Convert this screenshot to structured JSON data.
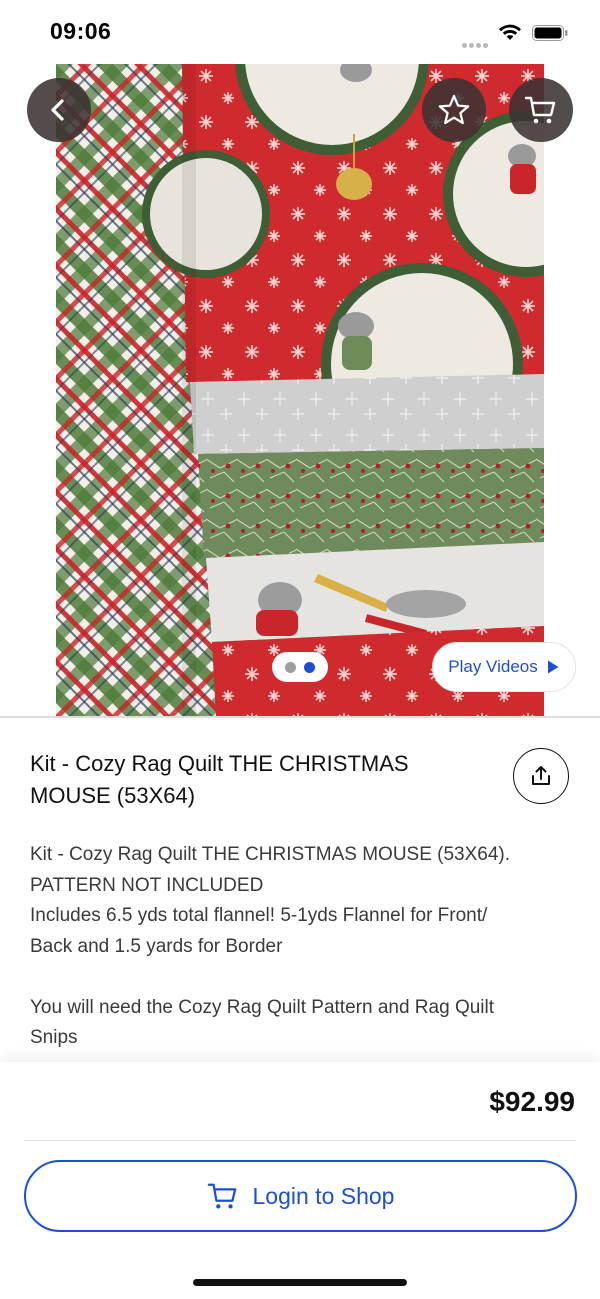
{
  "status_bar": {
    "time": "09:06"
  },
  "product": {
    "image_alt": "Christmas mouse flannel fabric bundle",
    "title": "Kit - Cozy Rag Quilt THE CHRISTMAS MOUSE (53X64)",
    "description": [
      "Kit - Cozy Rag Quilt THE CHRISTMAS MOUSE (53X64).",
      "PATTERN NOT INCLUDED",
      "Includes 6.5 yds total flannel!  5-1yds Flannel for Front/",
      "Back and 1.5 yards for Border",
      "",
      "You will need the Cozy Rag Quilt Pattern and Rag Quilt",
      "Snips"
    ],
    "price": "$92.99"
  },
  "gallery": {
    "page_count": 2,
    "active_page": 2
  },
  "actions": {
    "play_videos_label": "Play Videos",
    "login_label": "Login to Shop"
  },
  "icons": {
    "back": "chevron-left-icon",
    "favorite": "star-icon",
    "cart": "cart-icon",
    "share": "share-icon",
    "play": "play-icon"
  },
  "colors": {
    "accent": "#1f4fd1",
    "overlay_button": "#3c3232",
    "fabric_red": "#c8262a",
    "fabric_green": "#4f7a3a"
  }
}
